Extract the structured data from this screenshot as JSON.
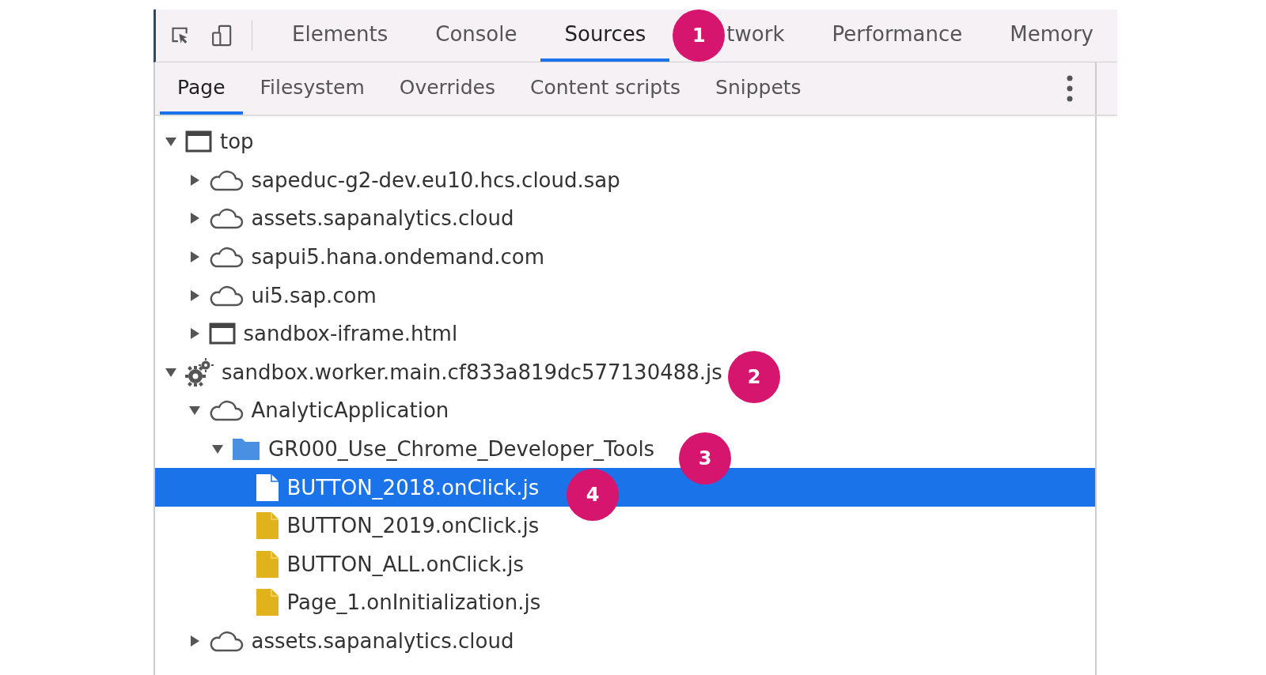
{
  "main_tabs": [
    {
      "label": "Elements",
      "selected": false
    },
    {
      "label": "Console",
      "selected": false
    },
    {
      "label": "Sources",
      "selected": true
    },
    {
      "label": "twork",
      "selected": false
    },
    {
      "label": "Performance",
      "selected": false
    },
    {
      "label": "Memory",
      "selected": false
    }
  ],
  "sub_tabs": [
    {
      "label": "Page",
      "selected": true
    },
    {
      "label": "Filesystem",
      "selected": false
    },
    {
      "label": "Overrides",
      "selected": false
    },
    {
      "label": "Content scripts",
      "selected": false
    },
    {
      "label": "Snippets",
      "selected": false
    }
  ],
  "tree": [
    {
      "kind": "frame",
      "label": "top",
      "expanded": true,
      "selected": false,
      "children": [
        {
          "kind": "cloud",
          "label": "sapeduc-g2-dev.eu10.hcs.cloud.sap",
          "expanded": false,
          "selected": false
        },
        {
          "kind": "cloud",
          "label": "assets.sapanalytics.cloud",
          "expanded": false,
          "selected": false
        },
        {
          "kind": "cloud",
          "label": "sapui5.hana.ondemand.com",
          "expanded": false,
          "selected": false
        },
        {
          "kind": "cloud",
          "label": "ui5.sap.com",
          "expanded": false,
          "selected": false
        },
        {
          "kind": "frame",
          "label": "sandbox-iframe.html",
          "expanded": false,
          "selected": false
        }
      ]
    },
    {
      "kind": "gear",
      "label": "sandbox.worker.main.cf833a819dc577130488.js",
      "expanded": true,
      "selected": false,
      "children": [
        {
          "kind": "cloud",
          "label": "AnalyticApplication",
          "expanded": true,
          "selected": false,
          "children": [
            {
              "kind": "folder",
              "label": "GR000_Use_Chrome_Developer_Tools",
              "expanded": true,
              "selected": false,
              "children": [
                {
                  "kind": "file",
                  "label": "BUTTON_2018.onClick.js",
                  "selected": true
                },
                {
                  "kind": "file",
                  "label": "BUTTON_2019.onClick.js",
                  "selected": false
                },
                {
                  "kind": "file",
                  "label": "BUTTON_ALL.onClick.js",
                  "selected": false
                },
                {
                  "kind": "file",
                  "label": "Page_1.onInitialization.js",
                  "selected": false
                }
              ]
            }
          ]
        },
        {
          "kind": "cloud",
          "label": "assets.sapanalytics.cloud",
          "expanded": false,
          "selected": false
        }
      ]
    }
  ],
  "callouts": [
    {
      "label": "1"
    },
    {
      "label": "2"
    },
    {
      "label": "3"
    },
    {
      "label": "4"
    }
  ]
}
